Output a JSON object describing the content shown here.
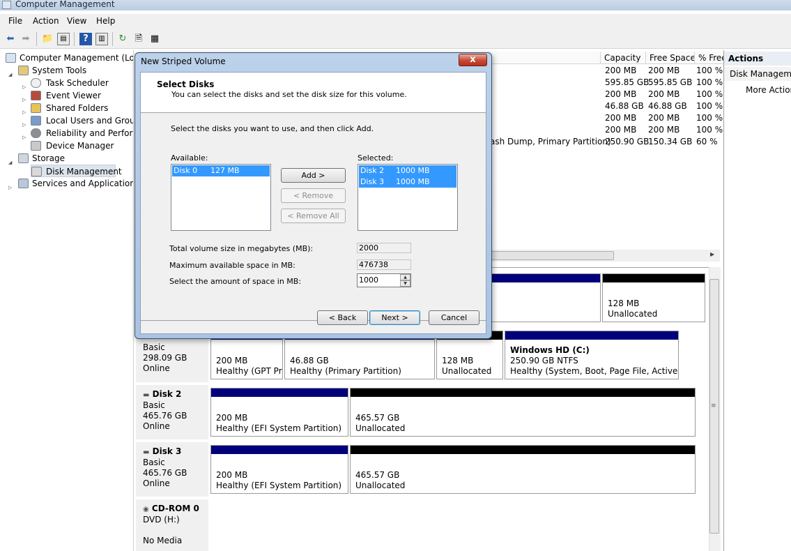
{
  "window": {
    "title": "Computer Management"
  },
  "menu": [
    "File",
    "Action",
    "View",
    "Help"
  ],
  "toolbar": {
    "icons": [
      "back-arrow-icon",
      "forward-arrow-icon",
      "up-folder-icon",
      "show-hide-tree-icon",
      "help-icon",
      "properties-pane-icon",
      "refresh-icon",
      "properties-icon",
      "export-list-icon"
    ]
  },
  "tree": {
    "root": "Computer Management (Local",
    "system_tools": "System Tools",
    "task_scheduler": "Task Scheduler",
    "event_viewer": "Event Viewer",
    "shared_folders": "Shared Folders",
    "local_users": "Local Users and Groups",
    "reliability": "Reliability and Performa",
    "device_manager": "Device Manager",
    "storage": "Storage",
    "disk_management": "Disk Management",
    "services": "Services and Applications"
  },
  "volume_list": {
    "columns": [
      "Capacity",
      "Free Space",
      "% Free"
    ],
    "rows": [
      {
        "desc": "",
        "capacity": "200 MB",
        "free": "200 MB",
        "pct": "100 %"
      },
      {
        "desc": "",
        "capacity": "595.85 GB",
        "free": "595.85 GB",
        "pct": "100 %"
      },
      {
        "desc": "",
        "capacity": "200 MB",
        "free": "200 MB",
        "pct": "100 %"
      },
      {
        "desc": "",
        "capacity": "46.88 GB",
        "free": "46.88 GB",
        "pct": "100 %"
      },
      {
        "desc": "",
        "capacity": "200 MB",
        "free": "200 MB",
        "pct": "100 %"
      },
      {
        "desc": "",
        "capacity": "200 MB",
        "free": "200 MB",
        "pct": "100 %"
      },
      {
        "desc": "ash Dump, Primary Partition)",
        "capacity": "250.90 GB",
        "free": "150.34 GB",
        "pct": "60 %"
      }
    ]
  },
  "disks": {
    "disk0_tail": {
      "size": "128 MB",
      "status": "Unallocated"
    },
    "disk1": {
      "type": "Basic",
      "size": "298.09 GB",
      "state": "Online",
      "parts": [
        {
          "line1": "200 MB",
          "line2": "Healthy (GPT Pro"
        },
        {
          "line1": "46.88 GB",
          "line2": "Healthy (Primary Partition)"
        },
        {
          "line1": "128 MB",
          "line2": "Unallocated"
        },
        {
          "name": "Windows HD  (C:)",
          "line1": "250.90 GB NTFS",
          "line2": "Healthy (System, Boot, Page File, Active, Cras"
        }
      ]
    },
    "disk2": {
      "name": "Disk 2",
      "type": "Basic",
      "size": "465.76 GB",
      "state": "Online",
      "parts": [
        {
          "line1": "200 MB",
          "line2": "Healthy (EFI System Partition)"
        },
        {
          "line1": "465.57 GB",
          "line2": "Unallocated"
        }
      ]
    },
    "disk3": {
      "name": "Disk 3",
      "type": "Basic",
      "size": "465.76 GB",
      "state": "Online",
      "parts": [
        {
          "line1": "200 MB",
          "line2": "Healthy (EFI System Partition)"
        },
        {
          "line1": "465.57 GB",
          "line2": "Unallocated"
        }
      ]
    },
    "cdrom": {
      "name": "CD-ROM 0",
      "type": "DVD (H:)",
      "state": "No Media"
    }
  },
  "actions": {
    "header": "Actions",
    "section": "Disk Managemer",
    "more": "More Action"
  },
  "dialog": {
    "title": "New Striped Volume",
    "close": "x",
    "heading": "Select Disks",
    "subheading": "You can select the disks and set the disk size for this volume.",
    "instruction": "Select the disks you want to use, and then click Add.",
    "available_label": "Available:",
    "selected_label": "Selected:",
    "available": [
      {
        "disk": "Disk 0",
        "size": "127 MB"
      }
    ],
    "selected": [
      {
        "disk": "Disk 2",
        "size": "1000 MB"
      },
      {
        "disk": "Disk 3",
        "size": "1000 MB"
      }
    ],
    "add_btn": "Add >",
    "remove_btn": "< Remove",
    "remove_all_btn": "< Remove All",
    "total_label": "Total volume size in megabytes (MB):",
    "total_value": "2000",
    "max_label": "Maximum available space in MB:",
    "max_value": "476738",
    "amount_label": "Select the amount of space in MB:",
    "amount_value": "1000",
    "back_btn": "< Back",
    "next_btn": "Next >",
    "cancel_btn": "Cancel"
  }
}
